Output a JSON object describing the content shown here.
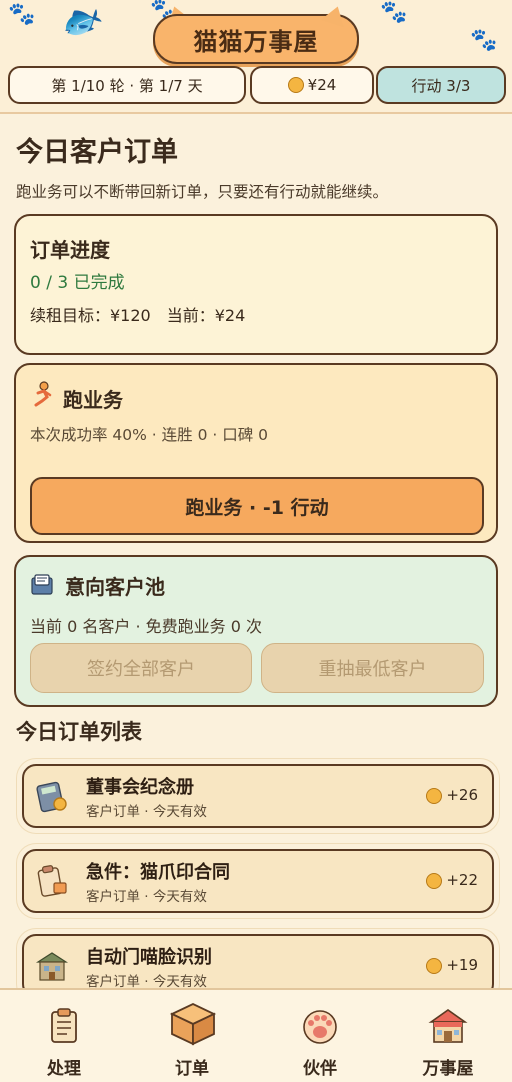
{
  "colors": {
    "background": "#fbf1dc",
    "accent_orange": "#f6a95e",
    "border_brown": "#5a3a22",
    "success_green": "#2f7a3f",
    "pool_card": "#e3f2e0"
  },
  "app": {
    "title": "猫猫万事屋"
  },
  "status": {
    "round_day": "第 1/10 轮 · 第 1/7 天",
    "money": "¥24",
    "actions": "行动 3/3"
  },
  "main": {
    "title": "今日客户订单",
    "subtitle": "跑业务可以不断带回新订单，只要还有行动就能继续。"
  },
  "order_progress": {
    "title": "订单进度",
    "completed": "0 / 3 已完成",
    "target": "续租目标：¥120　当前：¥24"
  },
  "errand": {
    "icon": "running-cat-icon",
    "title": "跑业务",
    "stats": "本次成功率 40% · 连胜 0 · 口碑 0",
    "button_label": "跑业务 · -1 行动"
  },
  "pool": {
    "icon": "card-file-icon",
    "title": "意向客户池",
    "info": "当前 0 名客户 · 免费跑业务 0 次",
    "sign_all_label": "签约全部客户",
    "redraw_label": "重抽最低客户"
  },
  "orders": {
    "title": "今日订单列表",
    "items": [
      {
        "icon": "calculator-icon",
        "title": "董事会纪念册",
        "meta": "客户订单 · 今天有效",
        "reward": "+26"
      },
      {
        "icon": "clipboard-icon",
        "title": "急件：猫爪印合同",
        "meta": "客户订单 · 今天有效",
        "reward": "+22"
      },
      {
        "icon": "building-icon",
        "title": "自动门喵脸识别",
        "meta": "客户订单 · 今天有效",
        "reward": "+19"
      }
    ]
  },
  "nav": {
    "items": [
      {
        "icon": "clipboard-icon",
        "label": "处理"
      },
      {
        "icon": "package-icon",
        "label": "订单"
      },
      {
        "icon": "paw-icon",
        "label": "伙伴"
      },
      {
        "icon": "house-icon",
        "label": "万事屋"
      }
    ]
  }
}
